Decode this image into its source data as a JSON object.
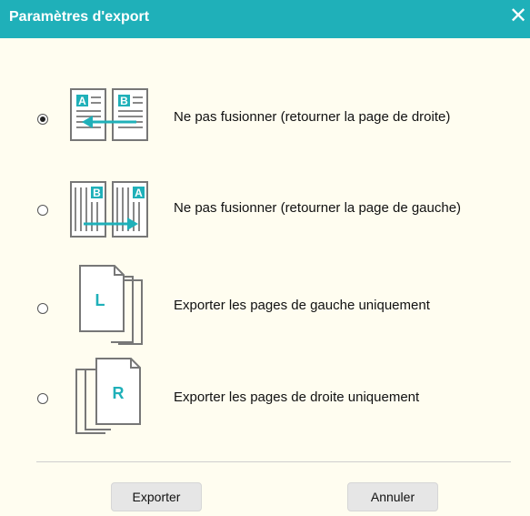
{
  "dialog": {
    "title": "Paramètres d'export",
    "close_glyph": "✕"
  },
  "options": [
    {
      "label": "Ne pas fusionner (retourner la page de droite)",
      "checked": true,
      "icon": "merge-right-page-icon",
      "letters": [
        "A",
        "B"
      ]
    },
    {
      "label": "Ne pas fusionner (retourner la page de gauche)",
      "checked": false,
      "icon": "merge-left-page-icon",
      "letters": [
        "B",
        "A"
      ]
    },
    {
      "label": "Exporter les pages de gauche uniquement",
      "checked": false,
      "icon": "left-pages-icon",
      "letters": [
        "L"
      ]
    },
    {
      "label": "Exporter les pages de droite uniquement",
      "checked": false,
      "icon": "right-pages-icon",
      "letters": [
        "R"
      ]
    }
  ],
  "buttons": {
    "export_label": "Exporter",
    "cancel_label": "Annuler"
  },
  "colors": {
    "accent": "#1fb0b9",
    "background": "#fffdf0",
    "icon_stroke": "#777777"
  }
}
